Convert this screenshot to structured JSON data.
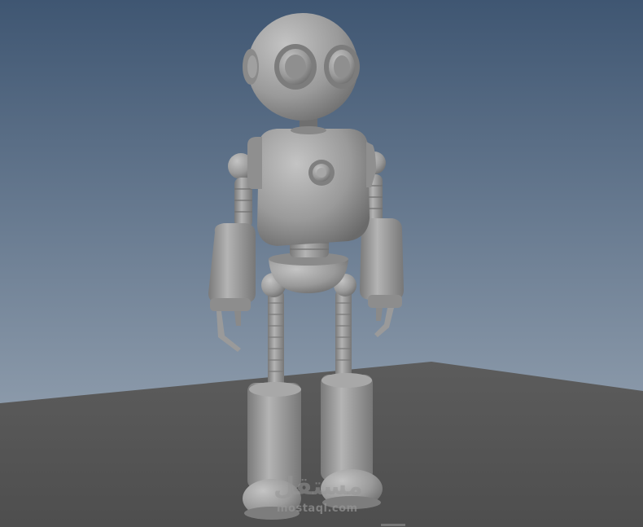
{
  "watermark": {
    "brand_arabic": "مستقل",
    "brand_latin": "mostaql.com"
  },
  "colors": {
    "sky_top": "#3f5672",
    "sky_bottom": "#a2aebb",
    "floor": "#555555",
    "robot_body": "#9a9a9a",
    "robot_shadow": "#6a6a6a",
    "robot_highlight": "#c2c2c2"
  }
}
